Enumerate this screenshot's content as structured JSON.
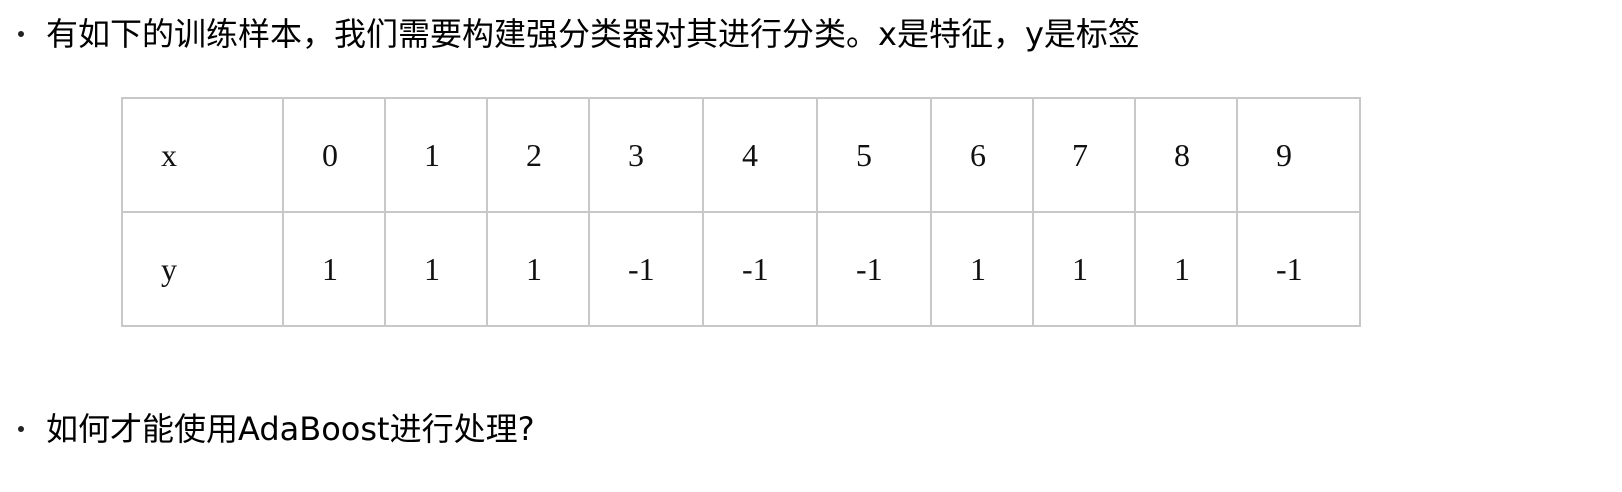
{
  "bullets": [
    {
      "text": "有如下的训练样本，我们需要构建强分类器对其进行分类。x是特征，y是标签"
    },
    {
      "text": "如何才能使用AdaBoost进行处理?"
    }
  ],
  "table": {
    "rows": [
      {
        "header": "x",
        "cells": [
          "0",
          "1",
          "2",
          "3",
          "4",
          "5",
          "6",
          "7",
          "8",
          "9"
        ]
      },
      {
        "header": "y",
        "cells": [
          "1",
          "1",
          "1",
          "-1",
          "-1",
          "-1",
          "1",
          "1",
          "1",
          "-1"
        ]
      }
    ]
  }
}
